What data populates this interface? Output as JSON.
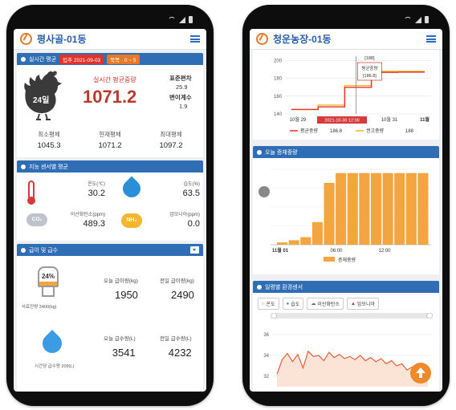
{
  "left": {
    "title": "평사골-01동",
    "realtime": {
      "header": "실시간 평균",
      "date_badge": "입추 2021-09-03",
      "zone_badge": "북쪽 · 0 ~ 5",
      "age": "24일",
      "avg_label": "실시간 평균중량",
      "avg_value": "1071.2",
      "std_label": "표준편차",
      "std_value": "25.9",
      "cv_label": "변이계수",
      "cv_value": "1.9",
      "min_label": "최소평체",
      "min_value": "1045.3",
      "cur_label": "현재평체",
      "cur_value": "1071.2",
      "max_label": "최대평체",
      "max_value": "1097.2"
    },
    "sensors": {
      "header": "지능 센서별 평균",
      "temp_label": "온도(℃)",
      "temp_value": "30.2",
      "hum_label": "습도(%)",
      "hum_value": "63.5",
      "co2_icon_text": "CO₂",
      "co2_label": "이산화탄소(ppm)",
      "co2_value": "489.3",
      "nh3_icon_text": "NH₃",
      "nh3_label": "암모니아(ppm)",
      "nh3_value": "0.0"
    },
    "feed": {
      "header": "급이 및 급수",
      "silo_pct": "24%",
      "silo_caption": "사료잔량 3400(kg)",
      "silo_level": 0.24,
      "today_feed_label": "오늘 급이량(kg)",
      "today_feed_value": "1950",
      "prev_feed_label": "전일 급이량(kg)",
      "prev_feed_value": "2490",
      "water_caption": "시간당 급수량 209(L)",
      "today_water_label": "오늘 급수량(L)",
      "today_water_value": "3541",
      "prev_water_label": "전일 급수량(L)",
      "prev_water_value": "4232"
    }
  },
  "right": {
    "title": "청운농장-01동",
    "weight_chart_legend": {
      "avg_name": "평균중량",
      "avg_value": "186.8",
      "std_name": "권고중량",
      "std_value": "188"
    },
    "today_weight": {
      "header": "오늘 증체중량",
      "legend": "증체중량"
    },
    "env": {
      "header": "일령별 환경센서",
      "btn_temp": "온도",
      "btn_hum": "습도",
      "btn_co2": "이산화탄소",
      "btn_nh3": "암모니아"
    }
  },
  "chart_data": [
    {
      "type": "line",
      "x": [
        "10월 29",
        "10월 30",
        "10월 31",
        "11월"
      ],
      "yticks": [
        140,
        160,
        180,
        200
      ],
      "ylim": [
        140,
        205
      ],
      "highlight_x_label": "2021-10-30 12:00",
      "tooltip": {
        "top": "[188]",
        "label": "평균중량",
        "value": "[186.8]"
      },
      "series": [
        {
          "name": "평균중량",
          "color": "#e2322b",
          "values": [
            145,
            148,
            170,
            186.8,
            187,
            187
          ]
        },
        {
          "name": "권고중량",
          "color": "#f2b630",
          "values": [
            145,
            150,
            172,
            188,
            188,
            188
          ]
        }
      ]
    },
    {
      "type": "bar",
      "x_labels": [
        "11월 01",
        "06:00",
        "12:00"
      ],
      "series_name": "증체중량",
      "color": "#f2a541",
      "values": [
        3,
        6,
        10,
        30,
        82,
        95,
        95,
        95,
        95,
        95,
        95,
        95,
        95
      ]
    },
    {
      "type": "line",
      "yticks": [
        32,
        34,
        36
      ],
      "ylim": [
        31,
        37
      ],
      "series": [
        {
          "name": "온도",
          "color": "#e2522b",
          "values": [
            32.2,
            33.6,
            34.2,
            33.4,
            34.1,
            32.8,
            34.4,
            33.9,
            34.0,
            33.5,
            34.3,
            33.8,
            34.1,
            33.7,
            33.9,
            33.6,
            34.0,
            33.5,
            33.8,
            33.4,
            33.7,
            33.2,
            33.5,
            33.0,
            33.2,
            32.6,
            32.9,
            32.4,
            32.7,
            32.3
          ]
        }
      ]
    }
  ]
}
